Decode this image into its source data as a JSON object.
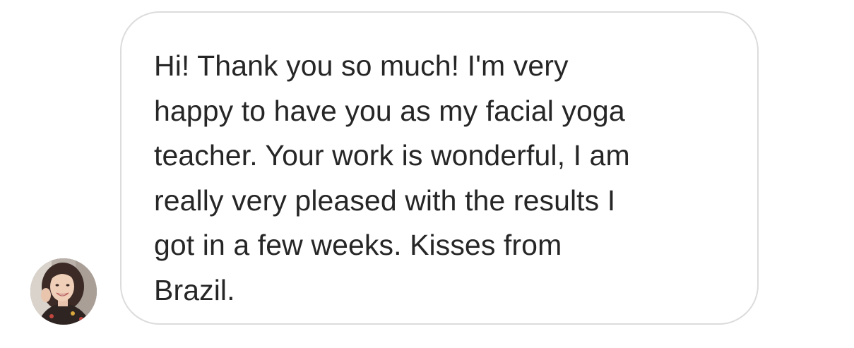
{
  "conversation": {
    "message": {
      "text": "Hi! Thank you so much! I'm very\nhappy to have you as my facial yoga\nteacher. Your work is wonderful, I am\nreally very pleased with the results I\ngot in a few weeks. Kisses from\nBrazil."
    },
    "sender": {
      "avatar_icon": "user-avatar-photo"
    },
    "colors": {
      "bubble_border": "#dcdcdc",
      "text": "#262626",
      "background": "#ffffff"
    }
  }
}
